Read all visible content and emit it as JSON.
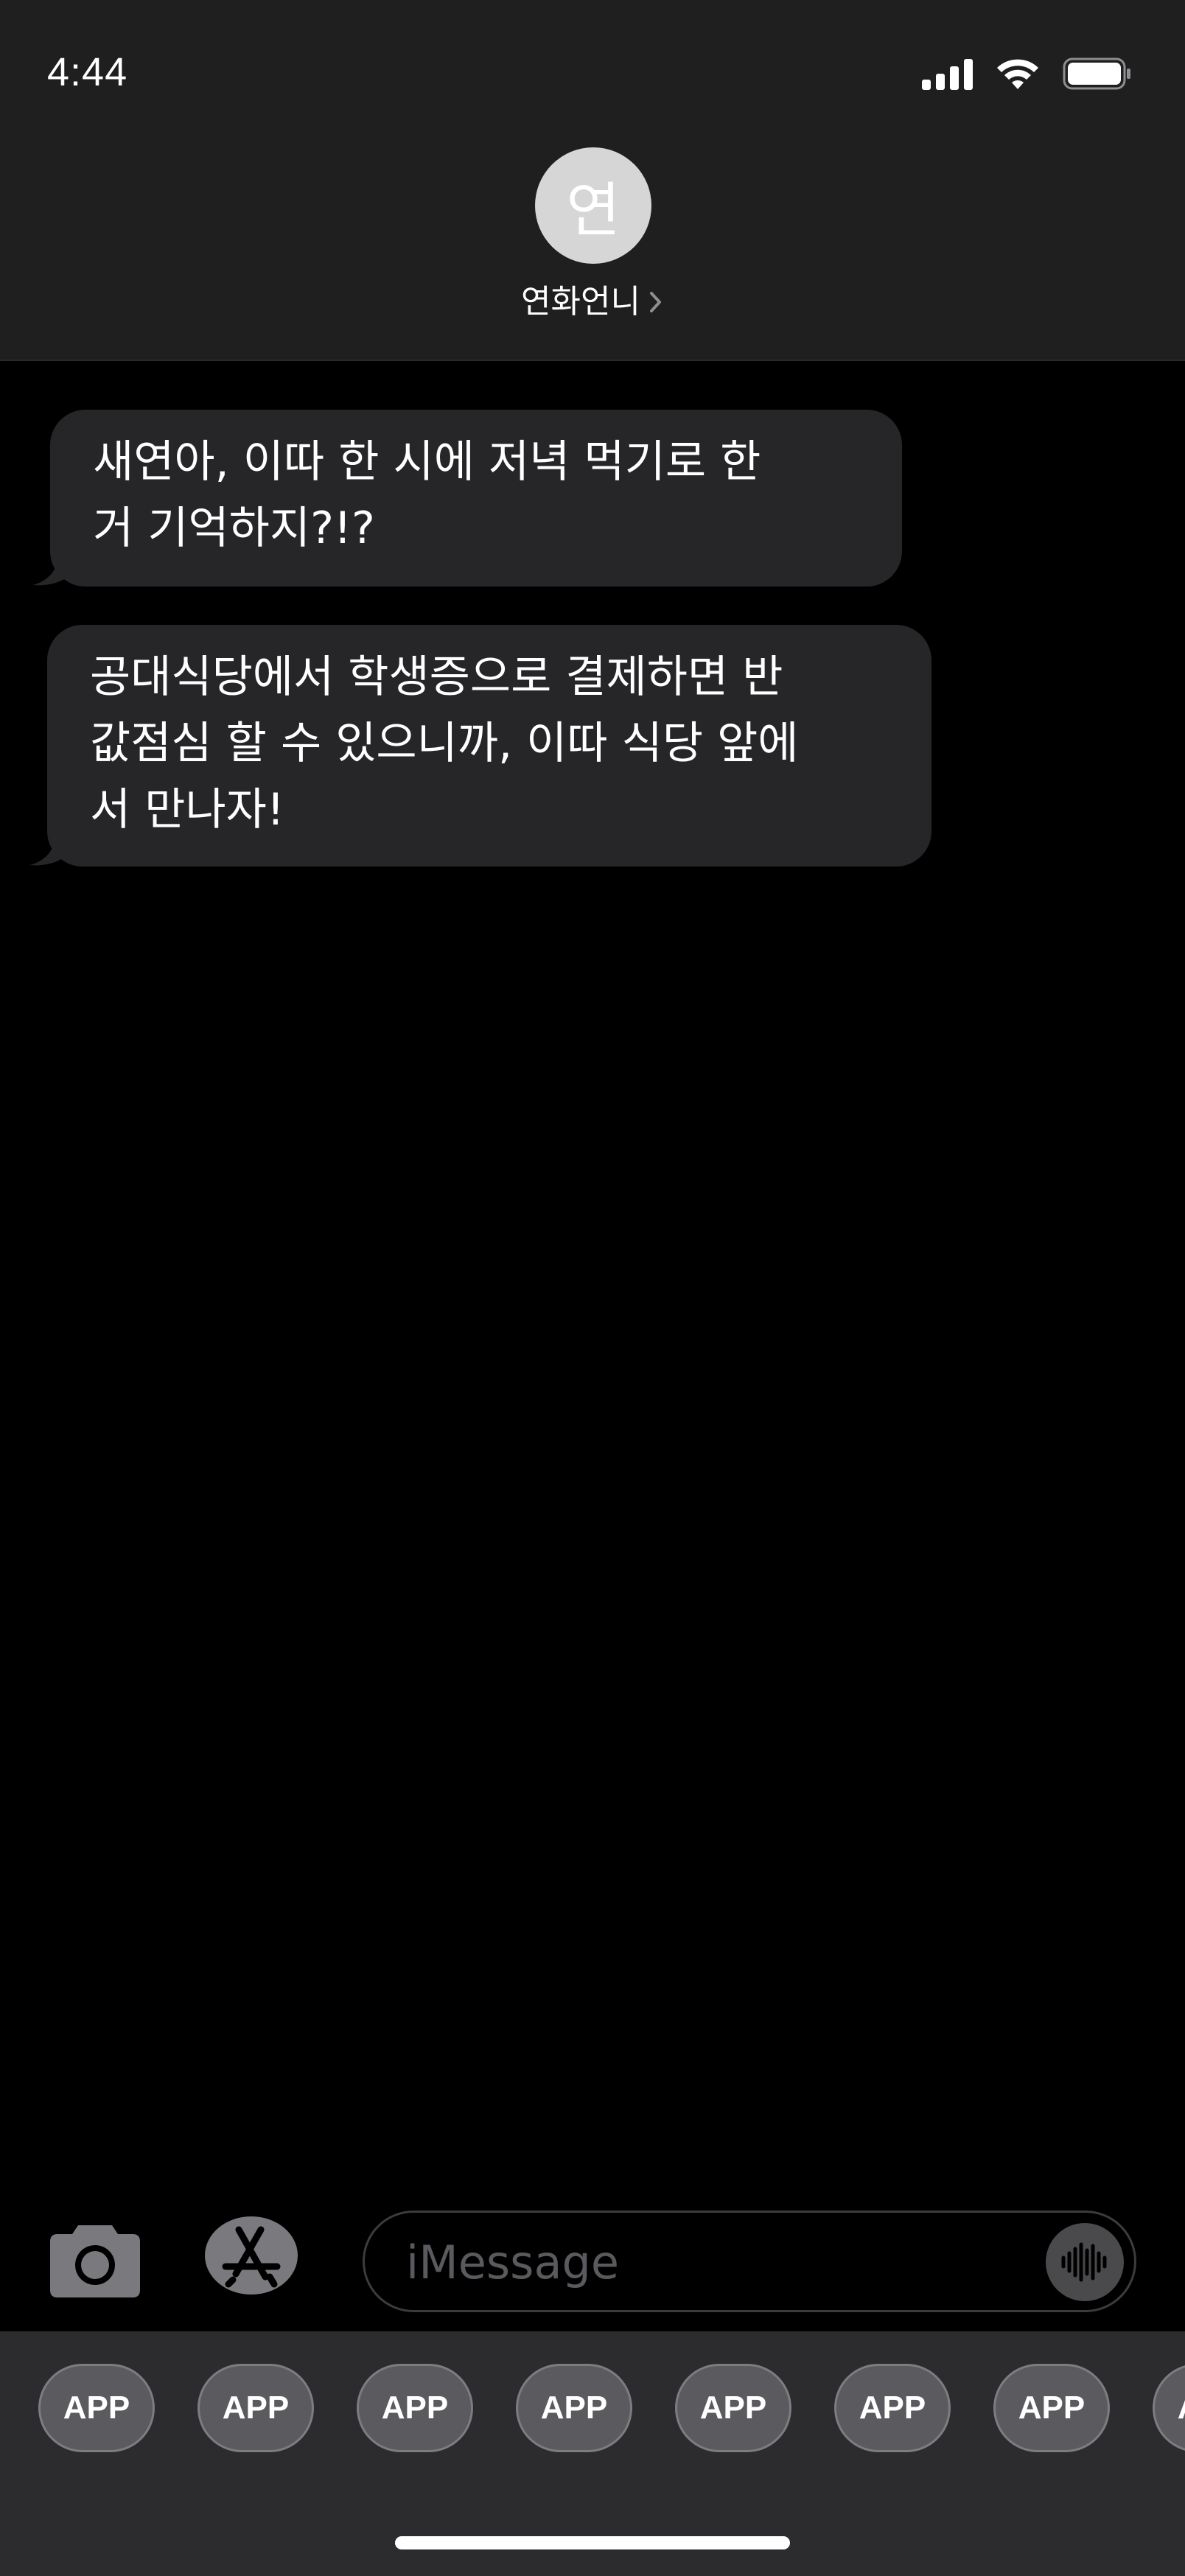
{
  "status_bar": {
    "time": "4:44"
  },
  "contact": {
    "avatar_initial": "연",
    "name": "연화언니"
  },
  "messages": [
    {
      "text": "새연아, 이따 한 시에 저녁 먹기로 한\n거 기억하지?!?"
    },
    {
      "text": "공대식당에서 학생증으로 결제하면 반\n값점심 할 수 있으니까, 이따 식당 앞에\n서 만나자!"
    }
  ],
  "composer": {
    "placeholder": "iMessage"
  },
  "app_drawer": {
    "apps": [
      "APP",
      "APP",
      "APP",
      "APP",
      "APP",
      "APP",
      "APP",
      "APP"
    ]
  },
  "colors": {
    "header_bg": "#1f1f1f",
    "bubble_bg": "#262628",
    "drawer_bg": "#2c2c2e"
  },
  "icons": {
    "status": [
      "signal-icon",
      "wifi-icon",
      "battery-icon"
    ],
    "composer": [
      "camera-icon",
      "appstore-icon",
      "waveform-icon"
    ],
    "header": [
      "chevron-right-icon"
    ]
  }
}
